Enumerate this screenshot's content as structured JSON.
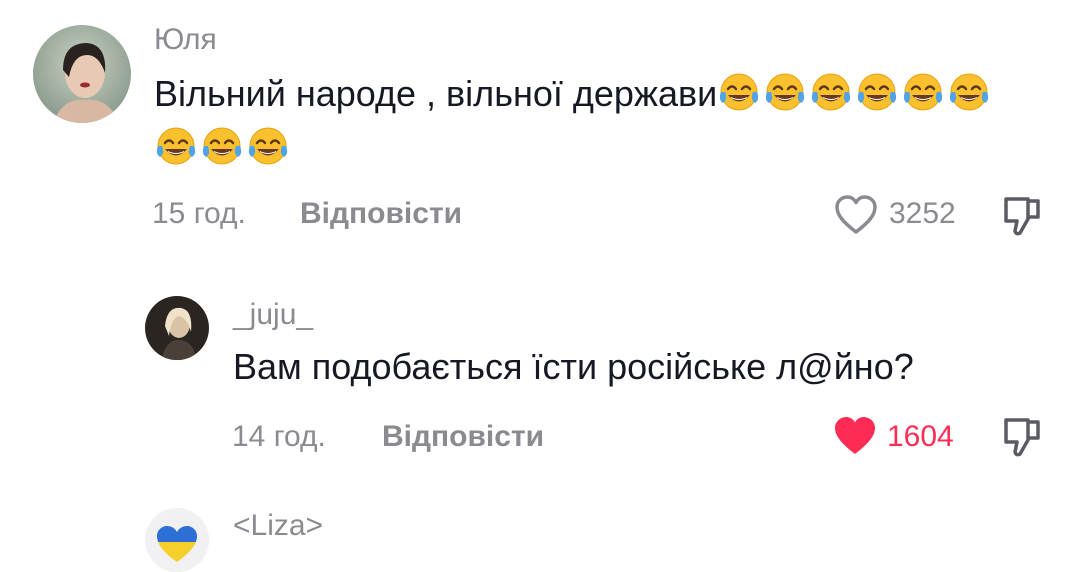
{
  "comments": [
    {
      "username": "Юля",
      "text": "Вільний народе , вільної держави",
      "emoji_icon": "face-with-tears-of-joy",
      "emoji_count": 9,
      "time": "15 год.",
      "reply_label": "Відповісти",
      "likes": "3252",
      "liked": false
    },
    {
      "username": "_juju_",
      "text": "Вам подобається їсти російське л@йно?",
      "time": "14 год.",
      "reply_label": "Відповісти",
      "likes": "1604",
      "liked": true
    },
    {
      "username": "<Liza>"
    }
  ],
  "colors": {
    "muted": "#8a8b91",
    "like_active": "#fe2c55",
    "text": "#161823"
  }
}
